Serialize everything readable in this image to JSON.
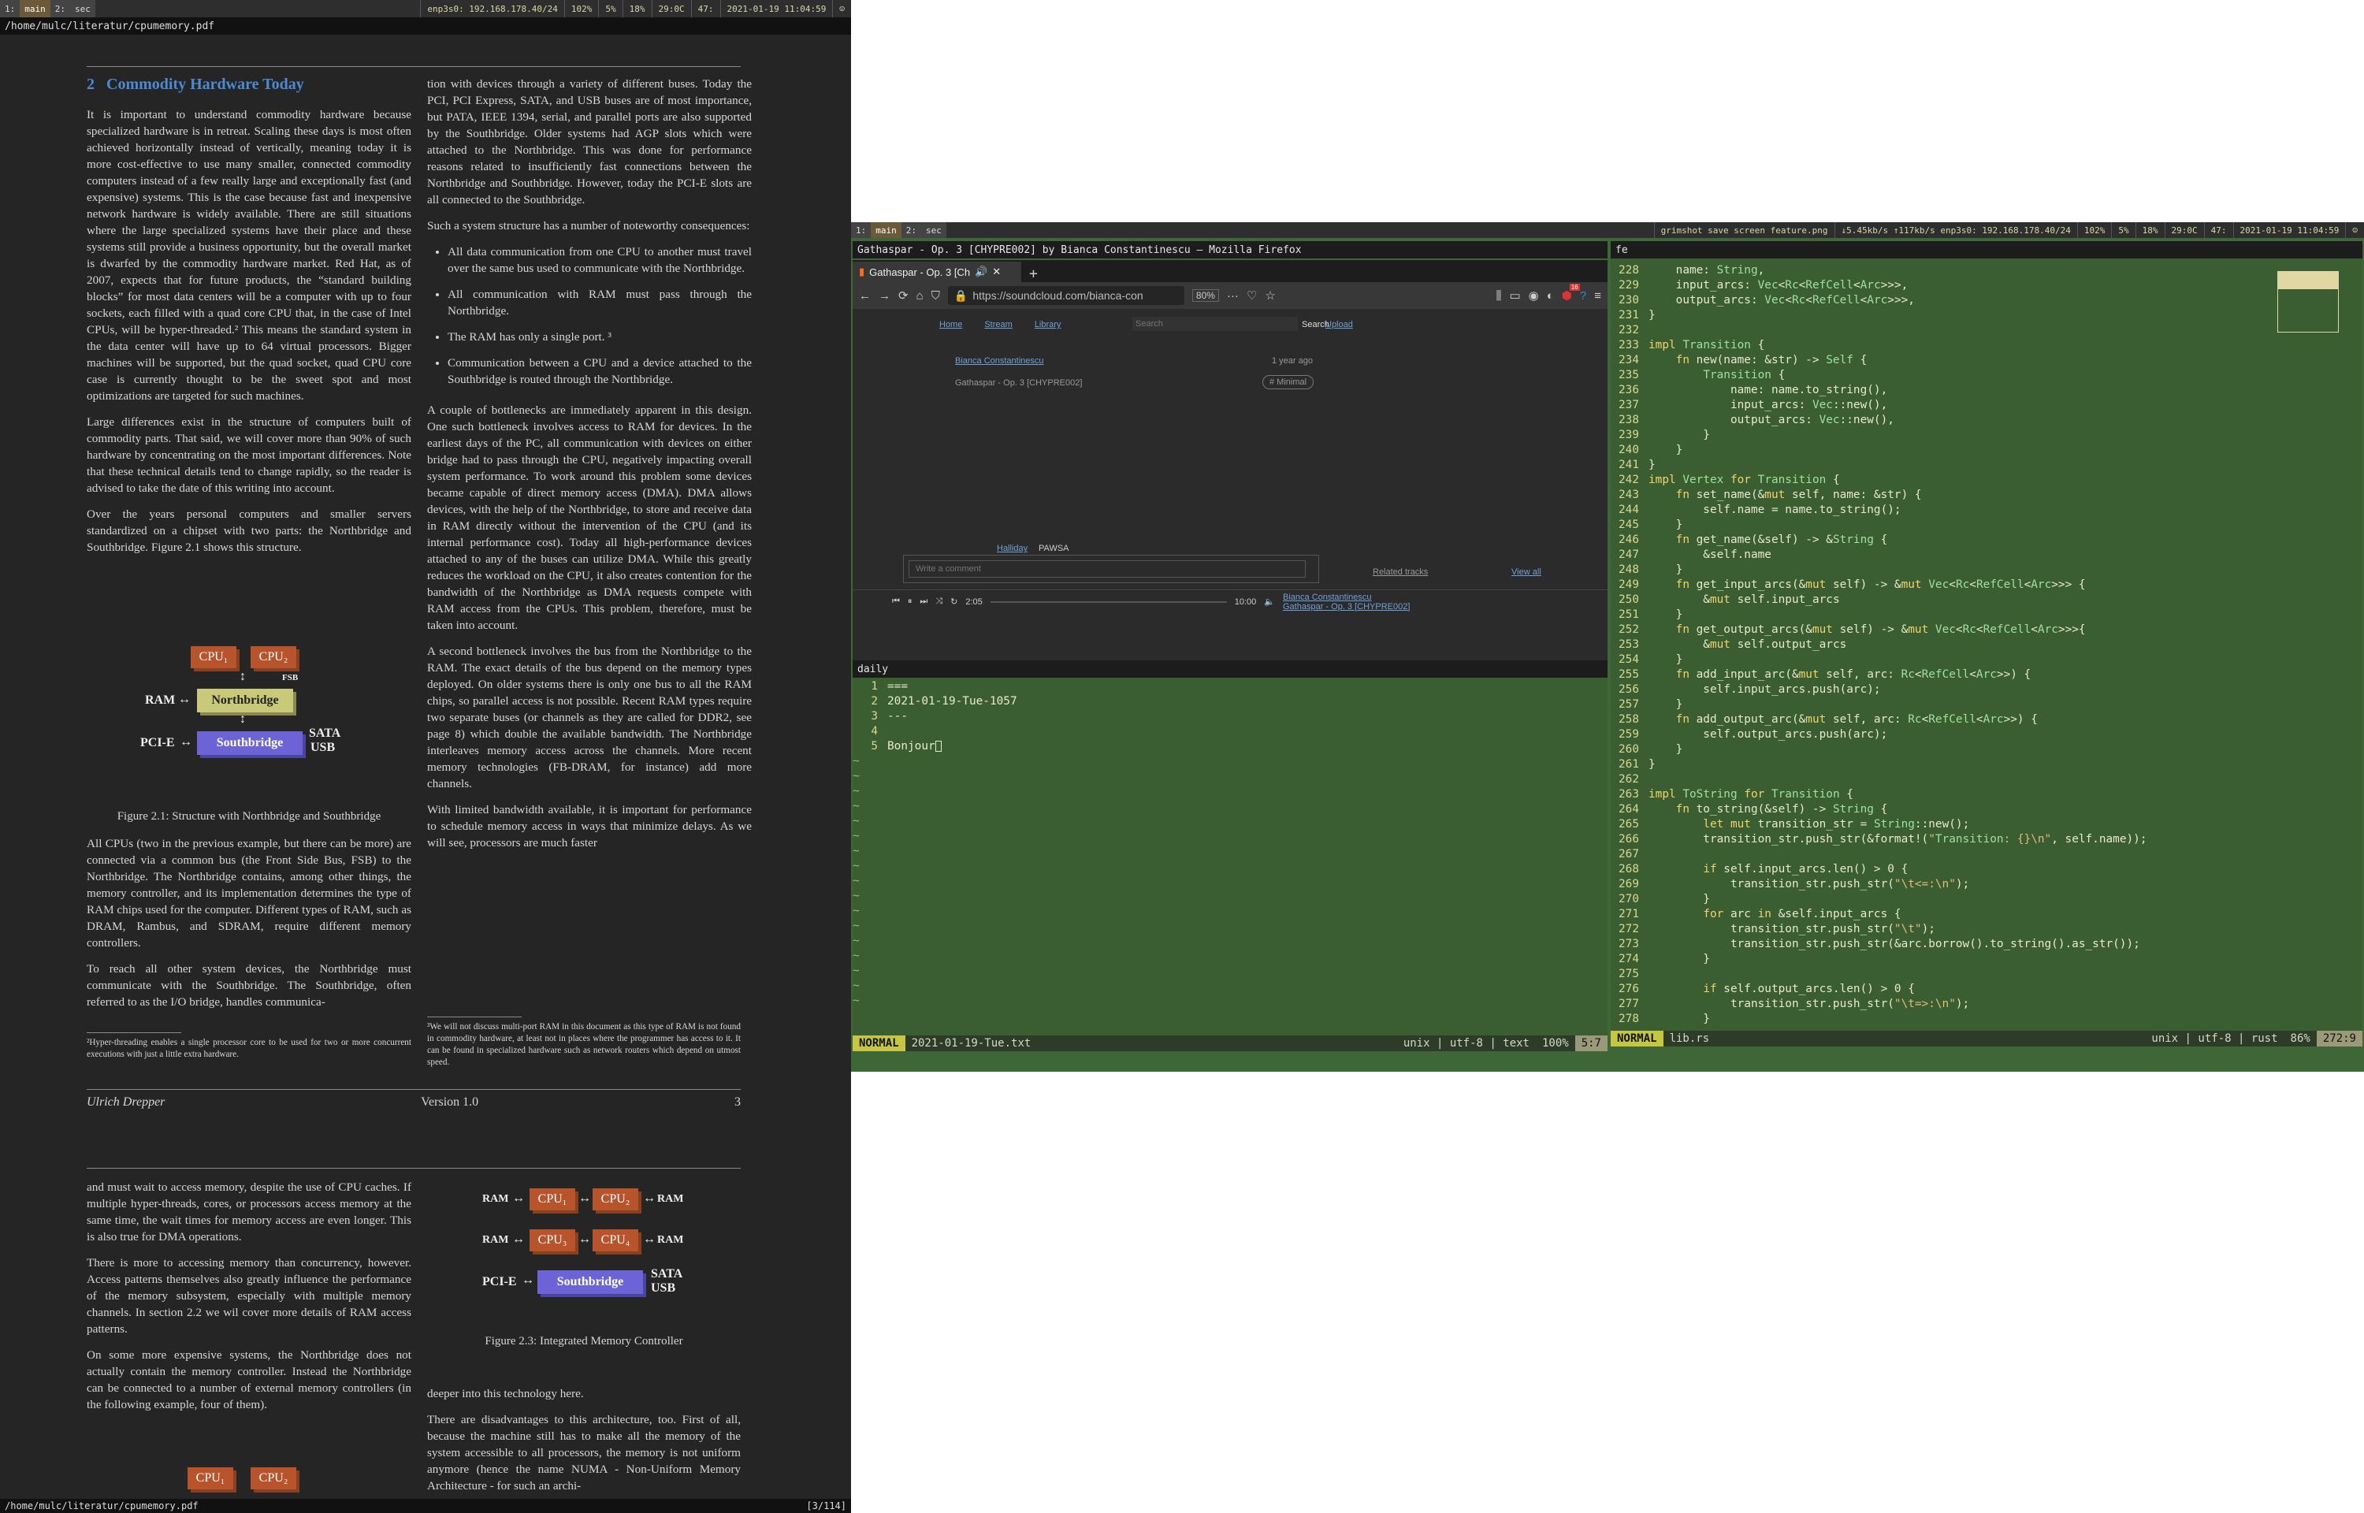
{
  "bar_left": {
    "workspaces": [
      "1:",
      "main",
      "2:",
      "sec"
    ],
    "segments": [
      "enp3s0: 192.168.178.40/24",
      "102%",
      "5%",
      "18%",
      "29:0C",
      "47:",
      "2021-01-19  11:04:59"
    ]
  },
  "bar_right": {
    "workspaces": [
      "1:",
      "main",
      "2:",
      "sec"
    ],
    "title": "grimshot save screen feature.png",
    "segments": [
      "↓5.45kb/s ↑117kb/s enp3s0: 192.168.178.40/24",
      "102%",
      "5%",
      "18%",
      "29:0C",
      "47:",
      "2021-01-19  11:04:59"
    ]
  },
  "pdf": {
    "path_top": "/home/mulc/literatur/cpumemory.pdf",
    "path_bottom": "/home/mulc/literatur/cpumemory.pdf",
    "page_indicator": "[3/114]",
    "heading_num": "2",
    "heading": "Commodity Hardware Today",
    "left_paragraphs": [
      "It is important to understand commodity hardware because specialized hardware is in retreat. Scaling these days is most often achieved horizontally instead of vertically, meaning today it is more cost-effective to use many smaller, connected commodity computers instead of a few really large and exceptionally fast (and expensive) systems. This is the case because fast and inexpensive network hardware is widely available. There are still situations where the large specialized systems have their place and these systems still provide a business opportunity, but the overall market is dwarfed by the commodity hardware market. Red Hat, as of 2007, expects that for future products, the “standard building blocks” for most data centers will be a computer with up to four sockets, each filled with a quad core CPU that, in the case of Intel CPUs, will be hyper-threaded.² This means the standard system in the data center will have up to 64 virtual processors. Bigger machines will be supported, but the quad socket, quad CPU core case is currently thought to be the sweet spot and most optimizations are targeted for such machines.",
      "Large differences exist in the structure of computers built of commodity parts. That said, we will cover more than 90% of such hardware by concentrating on the most important differences. Note that these technical details tend to change rapidly, so the reader is advised to take the date of this writing into account.",
      "Over the years personal computers and smaller servers standardized on a chipset with two parts: the Northbridge and Southbridge. Figure 2.1 shows this structure."
    ],
    "fig21": {
      "cpu1": "CPU₁",
      "cpu2": "CPU₂",
      "fsb": "FSB",
      "ram": "RAM",
      "nb": "Northbridge",
      "pcie": "PCI-E",
      "sb": "Southbridge",
      "sata": "SATA",
      "usb": "USB"
    },
    "fig21_caption": "Figure 2.1: Structure with Northbridge and Southbridge",
    "left_paragraphs2": [
      "All CPUs (two in the previous example, but there can be more) are connected via a common bus (the Front Side Bus, FSB) to the Northbridge. The Northbridge contains, among other things, the memory controller, and its implementation determines the type of RAM chips used for the computer. Different types of RAM, such as DRAM, Rambus, and SDRAM, require different memory controllers.",
      "To reach all other system devices, the Northbridge must communicate with the Southbridge. The Southbridge, often referred to as the I/O bridge, handles communica-"
    ],
    "footnote2": "²Hyper-threading enables a single processor core to be used for two or more concurrent executions with just a little extra hardware.",
    "right_paragraphs": [
      "tion with devices through a variety of different buses. Today the PCI, PCI Express, SATA, and USB buses are of most importance, but PATA, IEEE 1394, serial, and parallel ports are also supported by the Southbridge. Older systems had AGP slots which were attached to the Northbridge. This was done for performance reasons related to insufficiently fast connections between the Northbridge and Southbridge. However, today the PCI-E slots are all connected to the Southbridge.",
      "Such a system structure has a number of noteworthy consequences:"
    ],
    "bullets": [
      "All data communication from one CPU to another must travel over the same bus used to communicate with the Northbridge.",
      "All communication with RAM must pass through the Northbridge.",
      "The RAM has only a single port. ³",
      "Communication between a CPU and a device attached to the Southbridge is routed through the Northbridge."
    ],
    "right_paragraphs2": [
      "A couple of bottlenecks are immediately apparent in this design. One such bottleneck involves access to RAM for devices. In the earliest days of the PC, all communication with devices on either bridge had to pass through the CPU, negatively impacting overall system performance. To work around this problem some devices became capable of direct memory access (DMA). DMA allows devices, with the help of the Northbridge, to store and receive data in RAM directly without the intervention of the CPU (and its internal performance cost). Today all high-performance devices attached to any of the buses can utilize DMA. While this greatly reduces the workload on the CPU, it also creates contention for the bandwidth of the Northbridge as DMA requests compete with RAM access from the CPUs. This problem, therefore, must be taken into account.",
      "A second bottleneck involves the bus from the Northbridge to the RAM. The exact details of the bus depend on the memory types deployed. On older systems there is only one bus to all the RAM chips, so parallel access is not possible. Recent RAM types require two separate buses (or channels as they are called for DDR2, see page 8) which double the available bandwidth. The Northbridge interleaves memory access across the channels. More recent memory technologies (FB-DRAM, for instance) add more channels.",
      "With limited bandwidth available, it is important for performance to schedule memory access in ways that minimize delays. As we will see, processors are much faster"
    ],
    "footnote3": "³We will not discuss multi-port RAM in this document as this type of RAM is not found in commodity hardware, at least not in places where the programmer has access to it. It can be found in specialized hardware such as network routers which depend on utmost speed.",
    "footer_author": "Ulrich Drepper",
    "footer_version": "Version 1.0",
    "footer_page": "3",
    "p2_left": [
      "and must wait to access memory, despite the use of CPU caches. If multiple hyper-threads, cores, or processors access memory at the same time, the wait times for memory access are even longer. This is also true for DMA operations.",
      "There is more to accessing memory than concurrency, however. Access patterns themselves also greatly influence the performance of the memory subsystem, especially with multiple memory channels. In section 2.2 we wil cover more details of RAM access patterns.",
      "On some more expensive systems, the Northbridge does not actually contain the memory controller. Instead the Northbridge can be connected to a number of external memory controllers (in the following example, four of them)."
    ],
    "fig23": {
      "ram": "RAM",
      "cpu1": "CPU₁",
      "cpu2": "CPU₂",
      "cpu3": "CPU₃",
      "cpu4": "CPU₄",
      "pcie": "PCI-E",
      "sb": "Southbridge",
      "sata": "SATA",
      "usb": "USB"
    },
    "fig23_caption": "Figure 2.3: Integrated Memory Controller",
    "p2_right": [
      "deeper into this technology here.",
      "There are disadvantages to this architecture, too. First of all, because the machine still has to make all the memory of the system accessible to all processors, the memory is not uniform anymore (hence the name NUMA - Non-Uniform Memory Architecture - for such an archi-"
    ]
  },
  "firefox": {
    "window_title": "Gathaspar - Op. 3 [CHYPRE002] by Bianca Constantinescu — Mozilla Firefox",
    "tab_label": "Gathaspar - Op. 3 [Ch",
    "url": "https://soundcloud.com/bianca-con",
    "zoom": "80%",
    "badge_count": "16",
    "nav_items": [
      "Home",
      "Stream",
      "Library"
    ],
    "search_placeholder": "Search",
    "search_btn": "Search",
    "upload": "Upload",
    "user": "Bianca Constantinescu",
    "time_ago": "1 year ago",
    "track": "Gathaspar - Op. 3 [CHYPRE002]",
    "tag": "# Minimal",
    "commenters": [
      "Halliday",
      "PAWSA"
    ],
    "comment_placeholder": "Write a comment",
    "related": "Related tracks",
    "view_all": "View all",
    "player_elapsed": "2:05",
    "player_total": "10:00",
    "player_user": "Bianca Constantinescu",
    "player_track": "Gathaspar - Op. 3 [CHYPRE002]"
  },
  "vim_daily": {
    "title": "daily",
    "lines": [
      "===",
      "2021-01-19-Tue-1057",
      "---",
      "",
      "Bonjour"
    ],
    "mode": "NORMAL",
    "file": "2021-01-19-Tue.txt",
    "info": "unix | utf-8 | text",
    "percent": "100%",
    "pos": "5:7"
  },
  "vim_rust": {
    "title": "fe",
    "mode": "NORMAL",
    "file": "lib.rs",
    "info": "unix | utf-8 | rust",
    "percent": "86%",
    "pos": "272:9",
    "lines": [
      {
        "n": "228",
        "t": "    name: String,"
      },
      {
        "n": "229",
        "t": "    input_arcs: Vec<Rc<RefCell<Arc>>>,"
      },
      {
        "n": "230",
        "t": "    output_arcs: Vec<Rc<RefCell<Arc>>>,"
      },
      {
        "n": "231",
        "t": "}"
      },
      {
        "n": "232",
        "t": ""
      },
      {
        "n": "233",
        "t": "impl Transition {"
      },
      {
        "n": "234",
        "t": "    fn new(name: &str) -> Self {"
      },
      {
        "n": "235",
        "t": "        Transition {"
      },
      {
        "n": "236",
        "t": "            name: name.to_string(),"
      },
      {
        "n": "237",
        "t": "            input_arcs: Vec::new(),"
      },
      {
        "n": "238",
        "t": "            output_arcs: Vec::new(),"
      },
      {
        "n": "239",
        "t": "        }"
      },
      {
        "n": "240",
        "t": "    }"
      },
      {
        "n": "241",
        "t": "}"
      },
      {
        "n": "242",
        "t": "impl Vertex for Transition {"
      },
      {
        "n": "243",
        "t": "    fn set_name(&mut self, name: &str) {"
      },
      {
        "n": "244",
        "t": "        self.name = name.to_string();"
      },
      {
        "n": "245",
        "t": "    }"
      },
      {
        "n": "246",
        "t": "    fn get_name(&self) -> &String {"
      },
      {
        "n": "247",
        "t": "        &self.name"
      },
      {
        "n": "248",
        "t": "    }"
      },
      {
        "n": "249",
        "t": "    fn get_input_arcs(&mut self) -> &mut Vec<Rc<RefCell<Arc>>> {"
      },
      {
        "n": "250",
        "t": "        &mut self.input_arcs"
      },
      {
        "n": "251",
        "t": "    }"
      },
      {
        "n": "252",
        "t": "    fn get_output_arcs(&mut self) -> &mut Vec<Rc<RefCell<Arc>>>{"
      },
      {
        "n": "253",
        "t": "        &mut self.output_arcs"
      },
      {
        "n": "254",
        "t": "    }"
      },
      {
        "n": "255",
        "t": "    fn add_input_arc(&mut self, arc: Rc<RefCell<Arc>>) {"
      },
      {
        "n": "256",
        "t": "        self.input_arcs.push(arc);"
      },
      {
        "n": "257",
        "t": "    }"
      },
      {
        "n": "258",
        "t": "    fn add_output_arc(&mut self, arc: Rc<RefCell<Arc>>) {"
      },
      {
        "n": "259",
        "t": "        self.output_arcs.push(arc);"
      },
      {
        "n": "260",
        "t": "    }"
      },
      {
        "n": "261",
        "t": "}"
      },
      {
        "n": "262",
        "t": ""
      },
      {
        "n": "263",
        "t": "impl ToString for Transition {"
      },
      {
        "n": "264",
        "t": "    fn to_string(&self) -> String {"
      },
      {
        "n": "265",
        "t": "        let mut transition_str = String::new();"
      },
      {
        "n": "266",
        "t": "        transition_str.push_str(&format!(\"Transition: {}\\n\", self.name));"
      },
      {
        "n": "267",
        "t": ""
      },
      {
        "n": "268",
        "t": "        if self.input_arcs.len() > 0 {"
      },
      {
        "n": "269",
        "t": "            transition_str.push_str(\"\\t<=:\\n\");"
      },
      {
        "n": "270",
        "t": "        }"
      },
      {
        "n": "271",
        "t": "        for arc in &self.input_arcs {"
      },
      {
        "n": "272",
        "t": "            transition_str.push_str(\"\\t\");"
      },
      {
        "n": "273",
        "t": "            transition_str.push_str(&arc.borrow().to_string().as_str());"
      },
      {
        "n": "274",
        "t": "        }"
      },
      {
        "n": "275",
        "t": ""
      },
      {
        "n": "276",
        "t": "        if self.output_arcs.len() > 0 {"
      },
      {
        "n": "277",
        "t": "            transition_str.push_str(\"\\t=>:\\n\");"
      },
      {
        "n": "278",
        "t": "        }"
      }
    ]
  }
}
